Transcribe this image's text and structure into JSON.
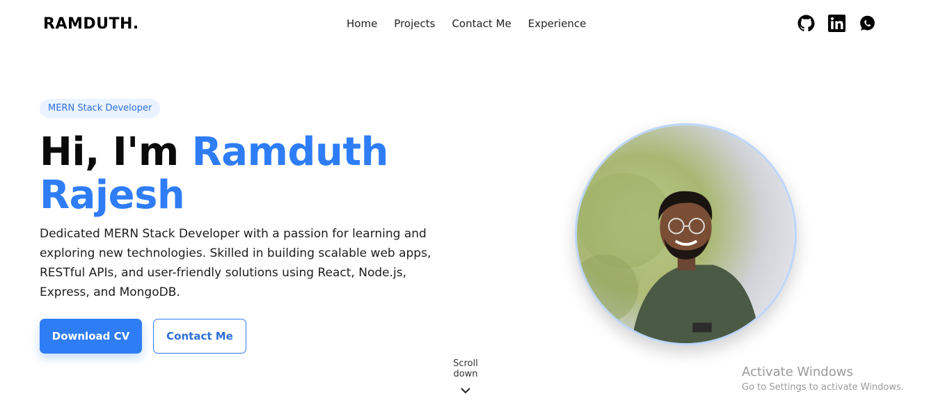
{
  "nav": {
    "logo": "RAMDUTH.",
    "links": [
      "Home",
      "Projects",
      "Contact Me",
      "Experience"
    ],
    "social_icons": [
      "github-icon",
      "linkedin-icon",
      "whatsapp-icon"
    ]
  },
  "hero": {
    "badge": "MERN Stack Developer",
    "greeting": "Hi, I'm",
    "name_line1": "Ramduth",
    "name_line2": "Rajesh",
    "description": "Dedicated MERN Stack Developer with a passion for learning and exploring new technologies. Skilled in building scalable web apps, RESTful APIs, and user-friendly solutions using React, Node.js, Express, and MongoDB.",
    "primary_button": "Download CV",
    "secondary_button": "Contact Me",
    "scroll_text": "Scroll down",
    "photo": "profile-photo"
  },
  "watermark": {
    "title": "Activate Windows",
    "subtitle": "Go to Settings to activate Windows."
  },
  "colors": {
    "accent": "#2f7df6",
    "badge_bg": "#eaf3ff",
    "text": "#111111"
  }
}
